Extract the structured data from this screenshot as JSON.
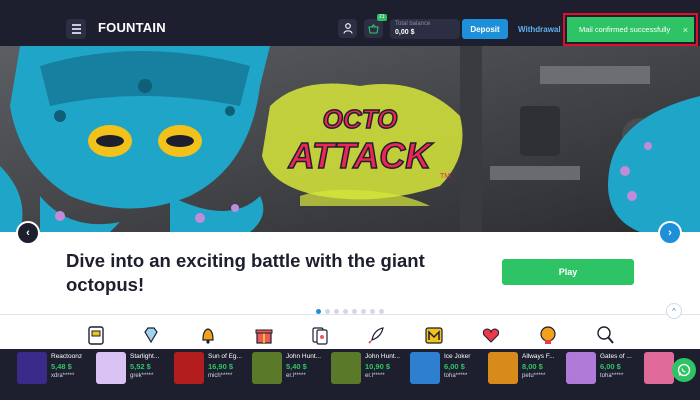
{
  "header": {
    "logo": "FOUNTAIN",
    "balance_label": "Total balance",
    "balance_value": "0,00 $",
    "deposit_label": "Deposit",
    "withdrawal_label": "Withdrawal",
    "basket_badge": "21"
  },
  "notification": {
    "text": "Mail confirmed successfully",
    "close": "×"
  },
  "banner": {
    "title_line1": "OCTO",
    "title_line2": "ATTACK",
    "title_tm": "TM"
  },
  "promo": {
    "title": "Dive into an exciting battle with the giant octopus!",
    "play_label": "Play"
  },
  "slider": {
    "prev": "‹",
    "next": "›",
    "up": "^"
  },
  "categories": [
    "slot-machine-icon",
    "diamond-icon",
    "bell-icon",
    "gift-icon",
    "cards-icon",
    "rocket-icon",
    "m-letter-icon",
    "heart-icon",
    "coin-icon",
    "magnifier-icon"
  ],
  "winners": [
    {
      "game": "Reactoonz",
      "amount": "5,48 $",
      "user": "xdra*****",
      "thumb_color": "#3a2a8a"
    },
    {
      "game": "Starlight...",
      "amount": "5,52 $",
      "user": "grek*****",
      "thumb_color": "#d9c3f5"
    },
    {
      "game": "Sun of Eg...",
      "amount": "16,90 $",
      "user": "mich*****",
      "thumb_color": "#b31d1d"
    },
    {
      "game": "John Hunt...",
      "amount": "5,40 $",
      "user": "er.l*****",
      "thumb_color": "#5a7a2a"
    },
    {
      "game": "John Hunt...",
      "amount": "10,90 $",
      "user": "er.l*****",
      "thumb_color": "#5a7a2a"
    },
    {
      "game": "Ice Joker",
      "amount": "6,00 $",
      "user": "toha*****",
      "thumb_color": "#2f7fd1"
    },
    {
      "game": "Allways F...",
      "amount": "8,00 $",
      "user": "petu*****",
      "thumb_color": "#d88a1a"
    },
    {
      "game": "Gates of ...",
      "amount": "6,00 $",
      "user": "toha*****",
      "thumb_color": "#b07ad9"
    },
    {
      "game": "",
      "amount": "",
      "user": "",
      "thumb_color": "#e06a9a"
    }
  ],
  "colors": {
    "header_bg": "#1d1f2e",
    "accent_blue": "#1e90d9",
    "success_green": "#2ec465",
    "highlight_red": "#e0102a"
  }
}
